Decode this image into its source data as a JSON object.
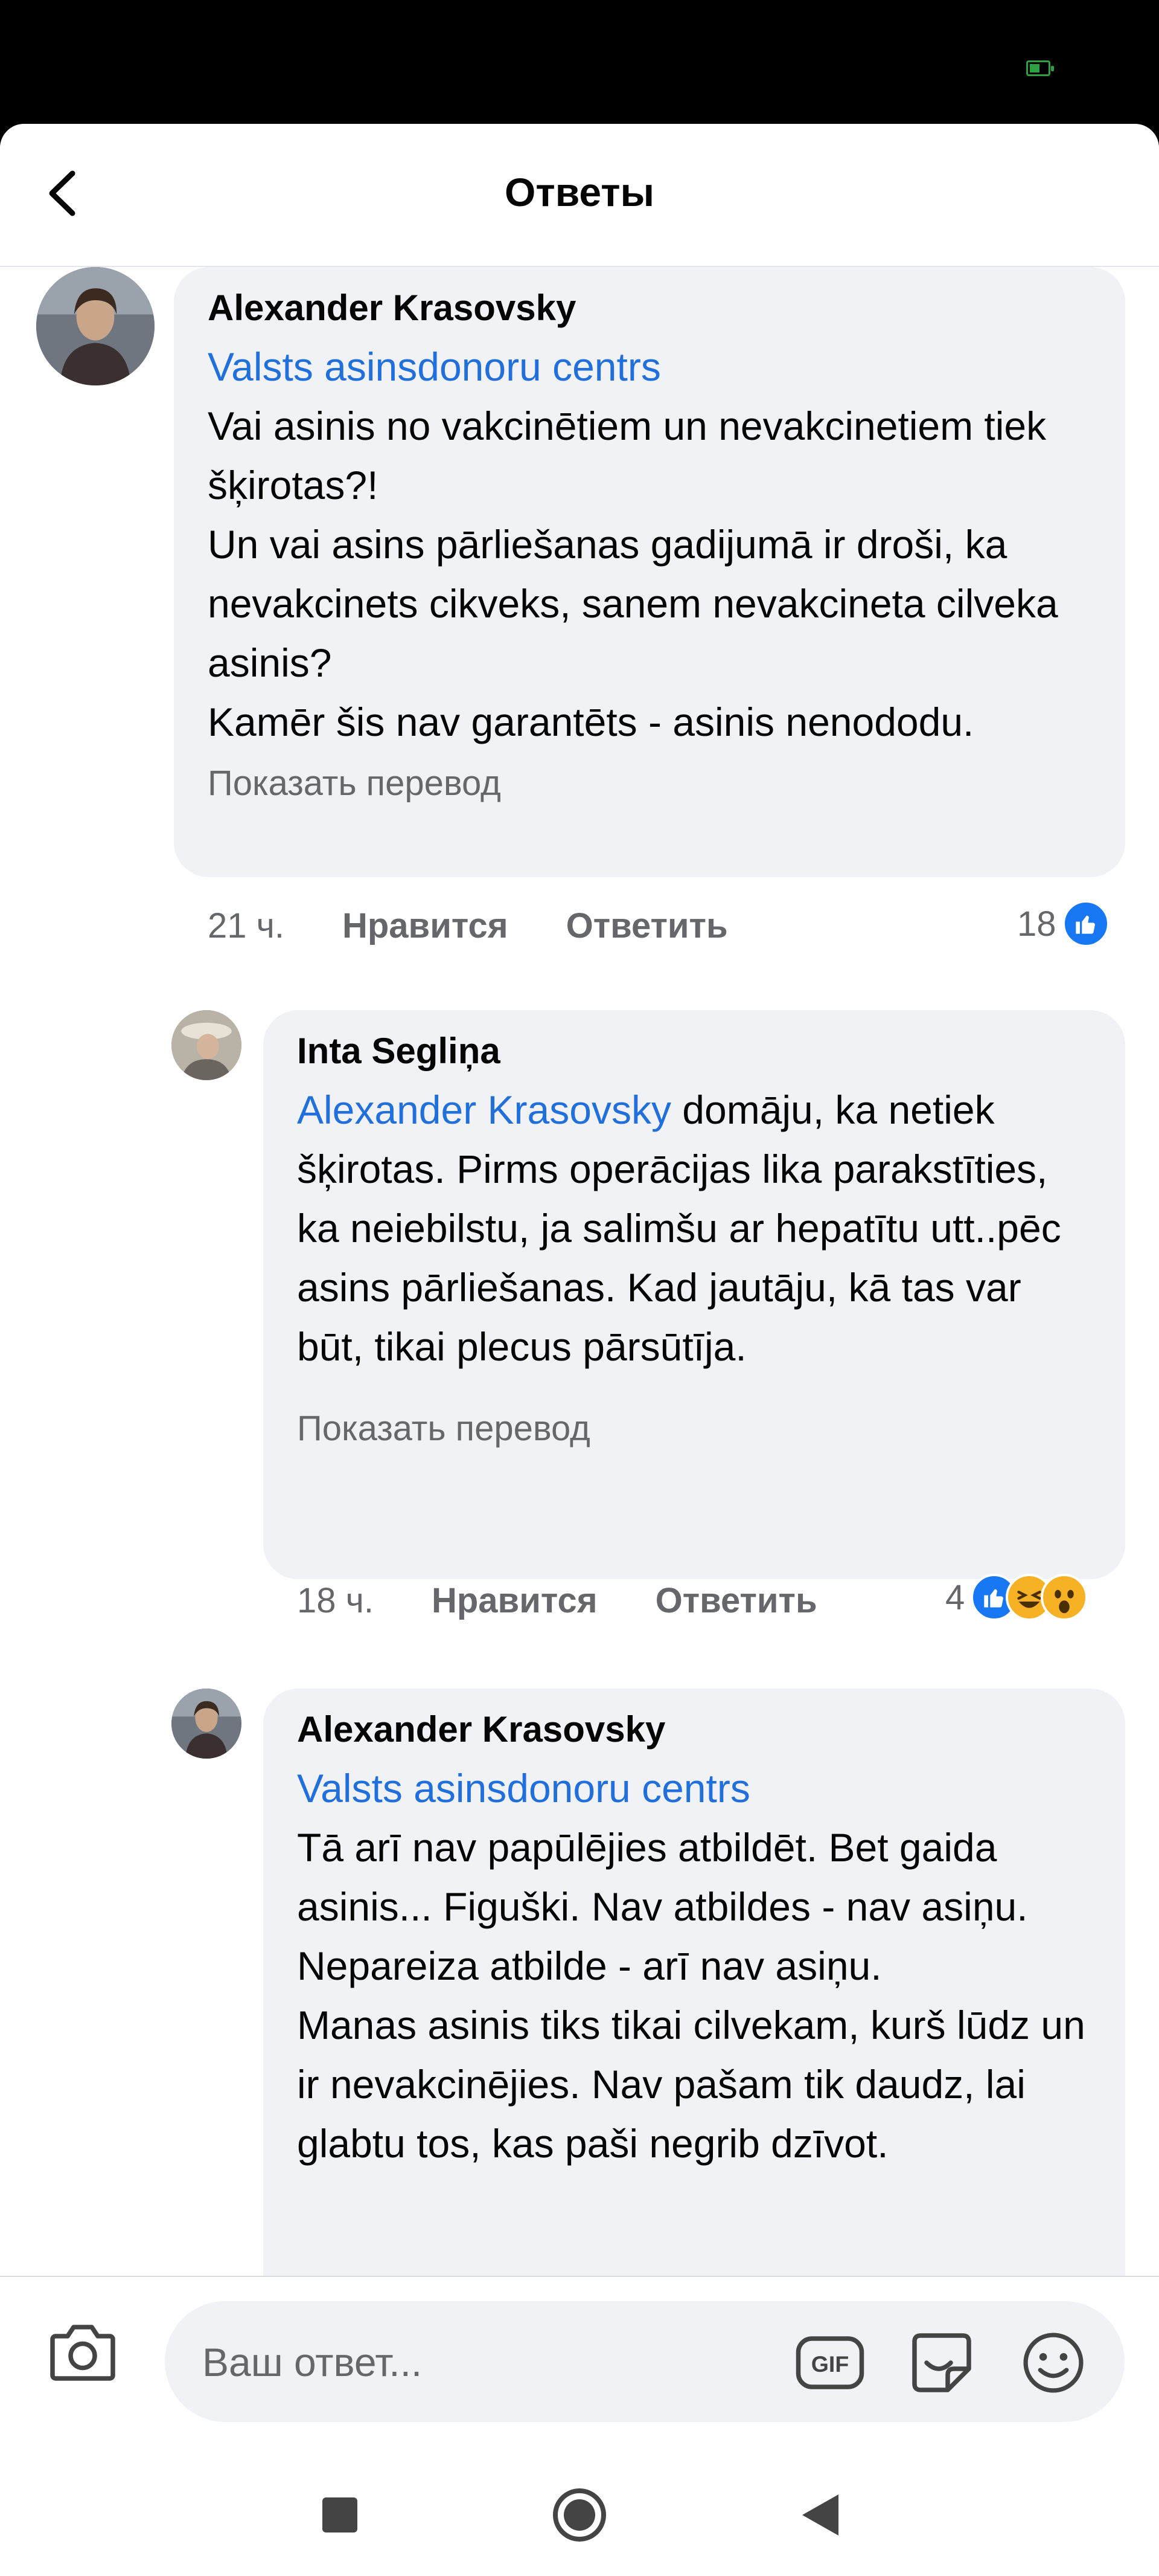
{
  "header": {
    "title": "Ответы"
  },
  "comments": [
    {
      "author": "Alexander Krasovsky",
      "mention": "Valsts asinsdonoru centrs",
      "text": [
        "Vai asinis no vakcinētiem un nevakcinetiem tiek šķirotas?!",
        "Un vai asins pārliešanas gadijumā ir droši, ka nevakcinets cikveks, sanem nevakcineta cilveka asinis?",
        "Kamēr šis nav garantēts - asinis nenododu."
      ],
      "translate": "Показать перевод",
      "time": "21 ч.",
      "like": "Нравится",
      "reply": "Ответить",
      "reactions_count": "18"
    },
    {
      "author": "Inta Segliņa",
      "mention": "Alexander Krasovsky",
      "text": [
        "domāju, ka netiek šķirotas. Pirms operācijas lika parakstīties, ka neiebilstu, ja salimšu ar hepatītu utt..pēc asins pārliešanas. Kad jautāju, kā tas var būt, tikai plecus pārsūtīja."
      ],
      "translate": "Показать перевод",
      "time": "18 ч.",
      "like": "Нравится",
      "reply": "Ответить",
      "reactions_count": "4"
    },
    {
      "author": "Alexander Krasovsky",
      "mention": "Valsts asinsdonoru centrs",
      "text": [
        "Tā arī nav papūlējies atbildēt. Bet gaida asinis... Figuški. Nav atbildes - nav asiņu. Nepareiza atbilde - arī nav asiņu.",
        "Manas asinis tiks tikai cilvekam, kurš lūdz un ir nevakcinējies. Nav pašam tik daudz, lai glabtu tos, kas paši negrib dzīvot."
      ]
    }
  ],
  "composer": {
    "placeholder": "Ваш ответ..."
  },
  "icons": {
    "back": "chevron-left-icon",
    "camera": "camera-icon",
    "gif": "gif-icon",
    "sticker": "sticker-icon",
    "emoji": "smiley-icon",
    "nav_recents": "square-icon",
    "nav_home": "circle-icon",
    "nav_back": "triangle-icon"
  },
  "colors": {
    "mention": "#216fdb",
    "like": "#1877f2",
    "bubble": "#f0f2f5",
    "battery": "#2ea043"
  }
}
